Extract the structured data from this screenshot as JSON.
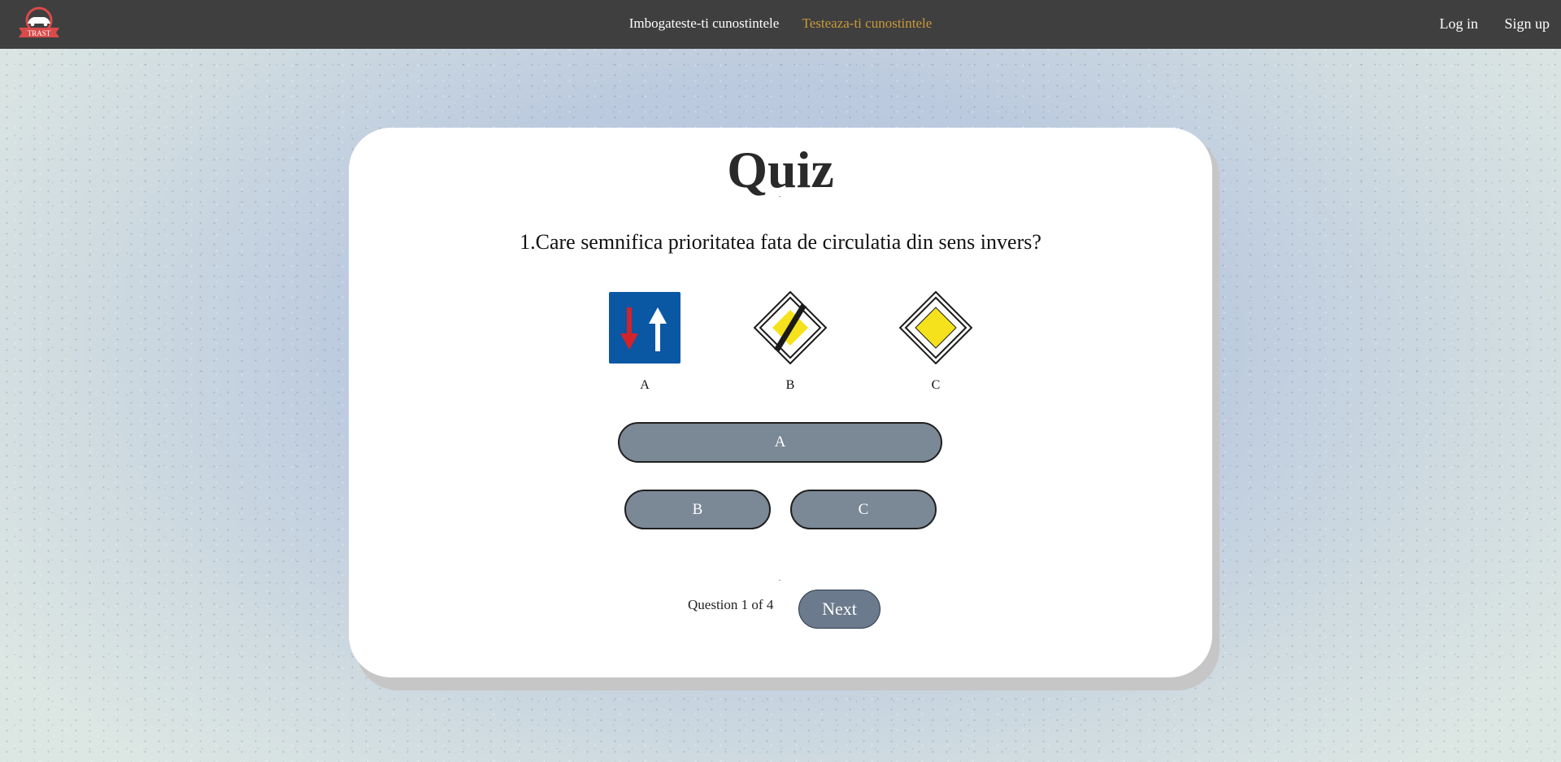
{
  "header": {
    "logo_text": "TRAST",
    "nav": [
      {
        "label": "Imbogateste-ti cunostintele",
        "active": false
      },
      {
        "label": "Testeaza-ti cunostintele",
        "active": true
      }
    ],
    "login_label": "Log in",
    "signup_label": "Sign up",
    "active_color": "#c99a3a"
  },
  "quiz": {
    "title": "Quiz",
    "question": "1.Care semnifica prioritatea fata de circulatia din sens invers?",
    "signs": [
      {
        "label": "A",
        "icon": "priority-over-oncoming-traffic-sign-icon"
      },
      {
        "label": "B",
        "icon": "end-of-priority-road-sign-icon"
      },
      {
        "label": "C",
        "icon": "priority-road-sign-icon"
      }
    ],
    "options": [
      "A",
      "B",
      "C"
    ],
    "progress": {
      "prefix": "Question",
      "current": "1",
      "of_label": "of",
      "total": "4"
    },
    "next_label": "Next"
  },
  "colors": {
    "topbar": "#3f3f3f",
    "button": "#7b8895",
    "next_button": "#6b7a8c"
  }
}
